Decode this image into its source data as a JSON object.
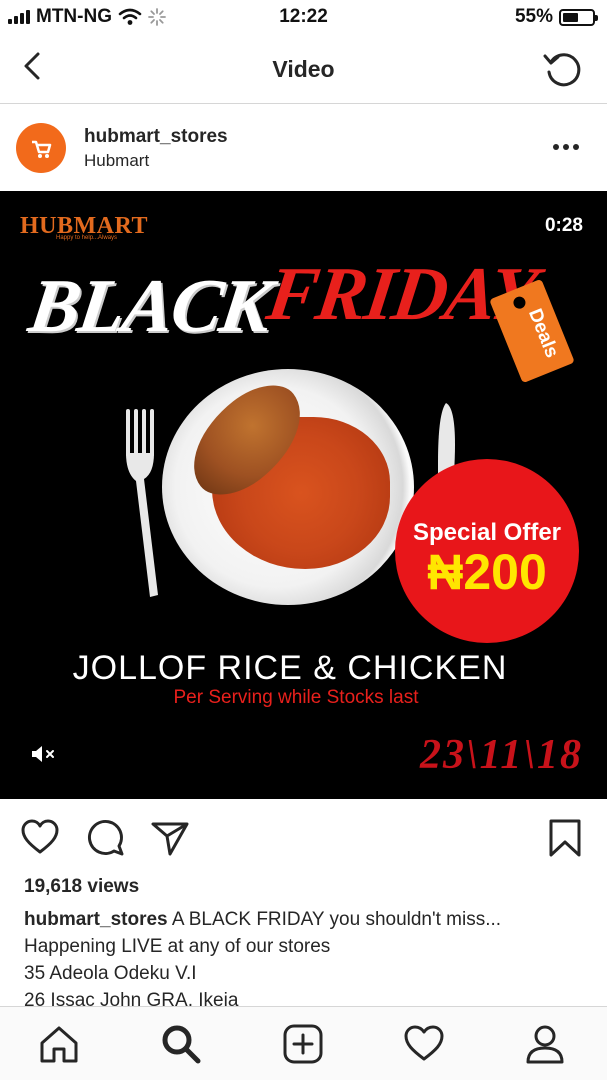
{
  "status_bar": {
    "carrier": "MTN-NG",
    "time": "12:22",
    "battery": "55%",
    "battery_level": 0.55
  },
  "nav": {
    "title": "Video",
    "back_icon": "chevron-left-icon",
    "refresh_icon": "refresh-icon"
  },
  "post": {
    "username": "hubmart_stores",
    "subtitle": "Hubmart",
    "more_icon": "more-horizontal-icon"
  },
  "media": {
    "brand": "HUBMART",
    "brand_tagline": "Happy to help...Always",
    "video_time": "0:28",
    "headline_black": "BLACK",
    "headline_friday": "FRIDAY",
    "deals_tag": "Deals",
    "offer_title": "Special Offer",
    "offer_price": "₦200",
    "dish_name": "JOLLOF RICE & CHICKEN",
    "dish_sub": "Per Serving while Stocks last",
    "date": "23\\11\\18",
    "mute_icon": "speaker-muted-icon",
    "colors": {
      "orange": "#f26a1b",
      "red": "#e8161a",
      "yellow": "#ffe600"
    }
  },
  "actions": {
    "like_icon": "heart-icon",
    "comment_icon": "comment-icon",
    "share_icon": "send-icon",
    "save_icon": "bookmark-icon"
  },
  "views": "19,618 views",
  "caption": {
    "username": "hubmart_stores",
    "line1": " A BLACK FRIDAY you shouldn't miss...",
    "line2": "Happening LIVE at any of our stores",
    "line3": "35 Adeola Odeku V.I",
    "line4": "26 Issac John GRA, Ikeja"
  },
  "tabbar": {
    "home_icon": "home-icon",
    "search_icon": "search-icon",
    "add_icon": "add-post-icon",
    "activity_icon": "heart-icon",
    "profile_icon": "profile-icon"
  }
}
